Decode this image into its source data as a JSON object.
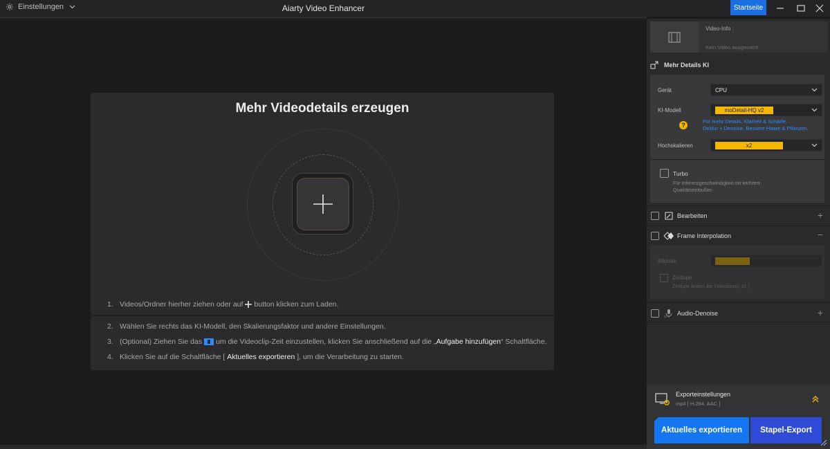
{
  "titlebar": {
    "settings_label": "Einstellungen",
    "app_title": "Aiarty Video Enhancer",
    "home_button": "Startseite"
  },
  "main": {
    "title": "Mehr Videodetails erzeugen",
    "steps": [
      {
        "num": "1.",
        "text_before": "Videos/Ordner hierher ziehen oder auf",
        "text_after": "button klicken zum Laden."
      },
      {
        "num": "2.",
        "text": "Wählen Sie rechts das KI-Modell, den Skalierungsfaktor und andere Einstellungen."
      },
      {
        "num": "3.",
        "text_before": "(Optional) Ziehen Sie das",
        "text_mid": "um die Videoclip-Zeit einzustellen, klicken Sie anschließend auf die „",
        "highlight": "Aufgabe hinzufügen",
        "text_after": "“ Schaltfläche."
      },
      {
        "num": "4.",
        "text_before": "Klicken Sie auf die Schaltfläche [",
        "highlight": "Aktuelles exportieren",
        "text_after": "], um die Verarbeitung zu starten."
      }
    ]
  },
  "sidebar": {
    "video_info_label": "Video-Info :",
    "video_info_value": "Kein Video ausgewählt",
    "section_details": "Mehr Details KI",
    "device_label": "Gerät",
    "device_value": "CPU",
    "model_label": "KI-Modell",
    "model_value": "moDetail-HQ  v2",
    "model_hint_1": "Für mehr Details, Klarheit & Schärfe.",
    "model_hint_2": "Deblur + Denoise. Bessere Haare & Pflanzen.",
    "upscale_label": "Hochskalieren",
    "upscale_value": "x2",
    "turbo_label": "Turbo",
    "turbo_desc_1": "Für Inferenzgeschwindigkeit mit leichtem",
    "turbo_desc_2": "Qualitätseinbußen",
    "section_edit": "Bearbeiten",
    "section_frame": "Frame Interpolation",
    "frame_rate_label": "Bildrate",
    "slowmo_label": "Zeitlupe",
    "slowmo_desc": "Zeitlupe ändert die Videodauer( x2 )",
    "section_audio": "Audio-Denoise",
    "export_title": "Exporteinstellungen",
    "export_sub": "mp4 [ H.264, AAC ]",
    "export_button": "Aktuelles exportieren",
    "batch_button": "Stapel-Export"
  },
  "colors": {
    "accent_blue": "#1476f0",
    "batch_blue": "#2f4bd6",
    "highlight_yellow": "#f5b800",
    "hint_blue": "#2c8cff"
  }
}
